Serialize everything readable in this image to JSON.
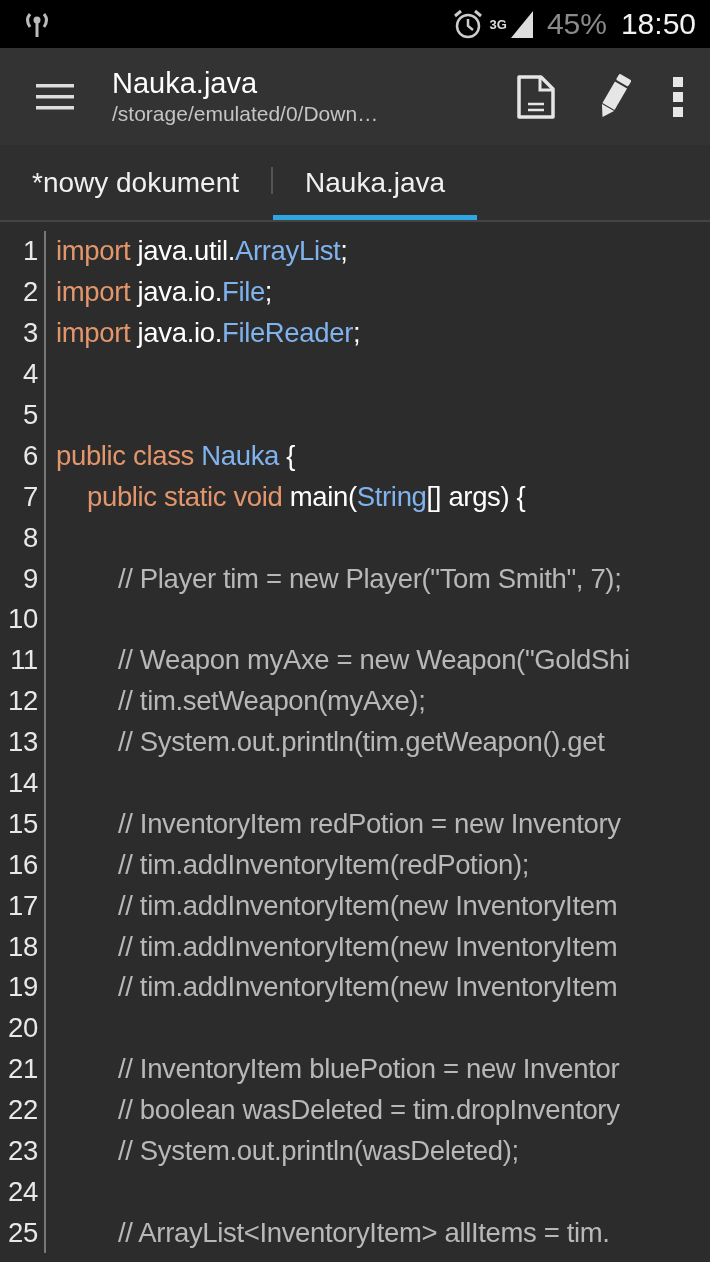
{
  "status_bar": {
    "network": "3G",
    "battery": "45%",
    "time": "18:50"
  },
  "toolbar": {
    "title": "Nauka.java",
    "subtitle": "/storage/emulated/0/Down…"
  },
  "tabs": [
    {
      "label": "*nowy dokument",
      "selected": false
    },
    {
      "label": "Nauka.java",
      "selected": true
    }
  ],
  "editor": {
    "lines": [
      {
        "number": "1",
        "tokens": [
          {
            "kind": "keyword",
            "text": "import"
          },
          {
            "kind": "plain",
            "text": " java.util."
          },
          {
            "kind": "type",
            "text": "ArrayList"
          },
          {
            "kind": "plain",
            "text": ";"
          }
        ]
      },
      {
        "number": "2",
        "tokens": [
          {
            "kind": "keyword",
            "text": "import"
          },
          {
            "kind": "plain",
            "text": " java.io."
          },
          {
            "kind": "type",
            "text": "File"
          },
          {
            "kind": "plain",
            "text": ";"
          }
        ]
      },
      {
        "number": "3",
        "tokens": [
          {
            "kind": "keyword",
            "text": "import"
          },
          {
            "kind": "plain",
            "text": " java.io."
          },
          {
            "kind": "type",
            "text": "FileReader"
          },
          {
            "kind": "plain",
            "text": ";"
          }
        ]
      },
      {
        "number": "4"
      },
      {
        "number": "5"
      },
      {
        "number": "6",
        "tokens": [
          {
            "kind": "keyword",
            "text": "public class "
          },
          {
            "kind": "type",
            "text": "Nauka"
          },
          {
            "kind": "plain",
            "text": " {"
          }
        ],
        "children": [
          {
            "number": "7",
            "tokens": [
              {
                "kind": "keyword",
                "text": "public static void "
              },
              {
                "kind": "plain",
                "text": "main("
              },
              {
                "kind": "type",
                "text": "String"
              },
              {
                "kind": "plain",
                "text": "[] args) {"
              }
            ],
            "children": [
              {
                "number": "8"
              },
              {
                "number": "9",
                "tokens": [
                  {
                    "kind": "comment",
                    "text": "// Player tim = new Player(\"Tom Smith\", 7);"
                  }
                ]
              },
              {
                "number": "10"
              },
              {
                "number": "11",
                "tokens": [
                  {
                    "kind": "comment",
                    "text": "// Weapon myAxe = new Weapon(\"GoldShi"
                  }
                ]
              },
              {
                "number": "12",
                "tokens": [
                  {
                    "kind": "comment",
                    "text": "// tim.setWeapon(myAxe);"
                  }
                ]
              },
              {
                "number": "13",
                "tokens": [
                  {
                    "kind": "comment",
                    "text": "// System.out.println(tim.getWeapon().get"
                  }
                ]
              },
              {
                "number": "14"
              },
              {
                "number": "15",
                "tokens": [
                  {
                    "kind": "comment",
                    "text": "// InventoryItem redPotion = new Inventory"
                  }
                ]
              },
              {
                "number": "16",
                "tokens": [
                  {
                    "kind": "comment",
                    "text": "// tim.addInventoryItem(redPotion);"
                  }
                ]
              },
              {
                "number": "17",
                "tokens": [
                  {
                    "kind": "comment",
                    "text": "// tim.addInventoryItem(new InventoryItem"
                  }
                ]
              },
              {
                "number": "18",
                "tokens": [
                  {
                    "kind": "comment",
                    "text": "// tim.addInventoryItem(new InventoryItem"
                  }
                ]
              },
              {
                "number": "19",
                "tokens": [
                  {
                    "kind": "comment",
                    "text": "// tim.addInventoryItem(new InventoryItem"
                  }
                ]
              },
              {
                "number": "20"
              },
              {
                "number": "21",
                "tokens": [
                  {
                    "kind": "comment",
                    "text": "// InventoryItem bluePotion = new Inventor"
                  }
                ]
              },
              {
                "number": "22",
                "tokens": [
                  {
                    "kind": "comment",
                    "text": "// boolean wasDeleted = tim.dropInventory"
                  }
                ]
              },
              {
                "number": "23",
                "tokens": [
                  {
                    "kind": "comment",
                    "text": "// System.out.println(wasDeleted);"
                  }
                ]
              },
              {
                "number": "24"
              },
              {
                "number": "25",
                "tokens": [
                  {
                    "kind": "comment",
                    "text": "// ArrayList<InventoryItem> allItems = tim."
                  }
                ]
              }
            ]
          }
        ]
      }
    ]
  }
}
